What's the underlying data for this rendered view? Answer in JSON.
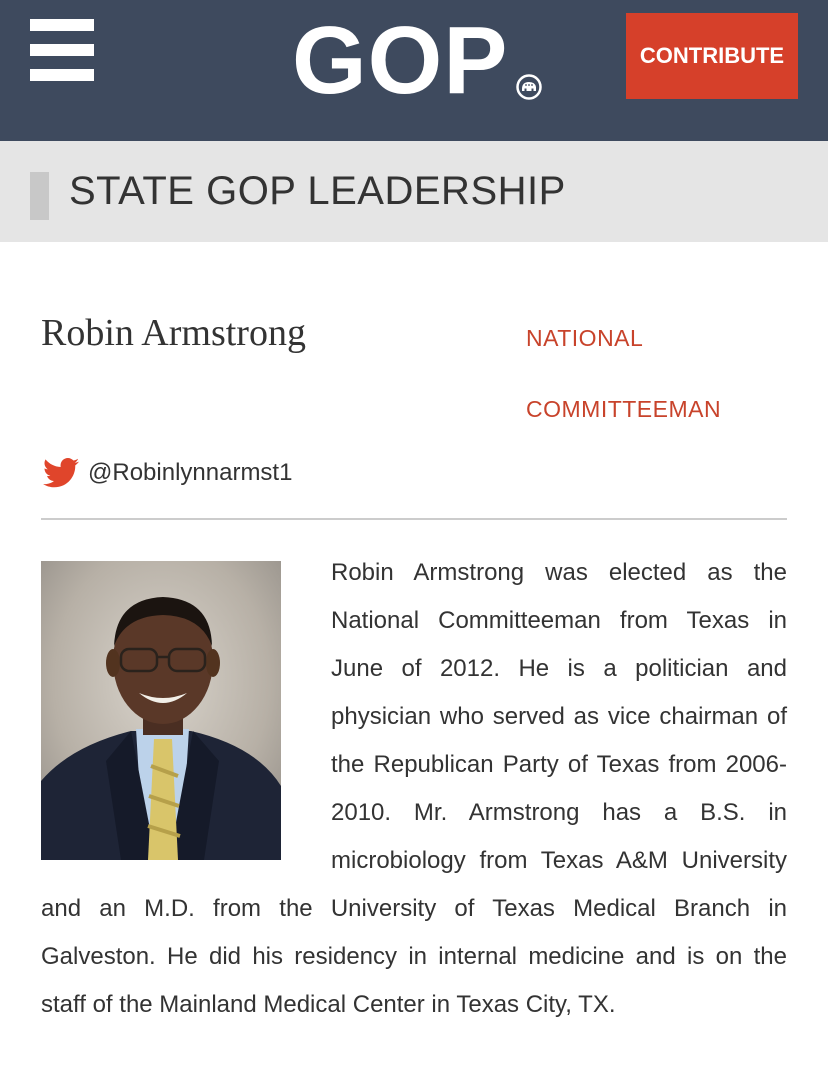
{
  "header": {
    "menu_icon": "hamburger-menu-icon",
    "logo_text": "GOP",
    "logo_mark_icon": "elephant-seal-icon",
    "contribute_label": "CONTRIBUTE",
    "background_color": "#3e4a5e",
    "accent_color": "#d6402a"
  },
  "section": {
    "title": "STATE GOP LEADERSHIP"
  },
  "profile": {
    "name": "Robin Armstrong",
    "role_line1": "NATIONAL",
    "role_line2": "COMMITTEEMAN",
    "twitter_icon": "twitter-bird-icon",
    "twitter_handle": "@Robinlynnarmst1",
    "photo_icon": "portrait-photo",
    "bio": "Robin Armstrong was elected as the National Committeeman from Texas in June of 2012. He is a politician and physician who served as vice chairman of the Republican Party of Texas from 2006-2010. Mr. Armstrong has a B.S. in microbiology from Texas A&M University and an M.D. from the University of Texas Medical Branch in Galveston. He did his residency in internal medicine and is on the staff of the Mainland Medical Center in Texas City, TX."
  }
}
